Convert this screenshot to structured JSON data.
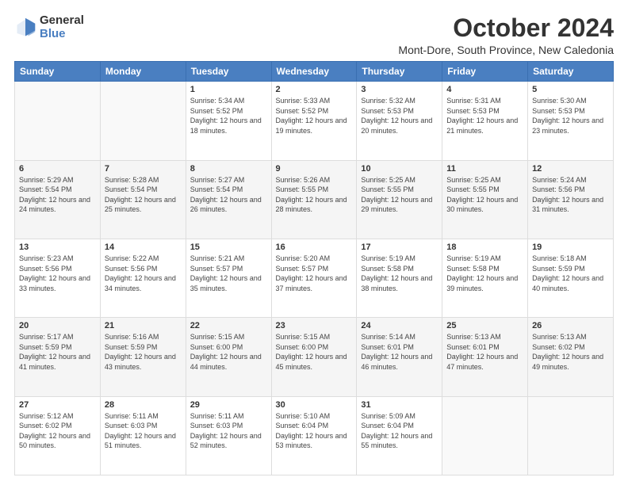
{
  "logo": {
    "general": "General",
    "blue": "Blue"
  },
  "header": {
    "month": "October 2024",
    "location": "Mont-Dore, South Province, New Caledonia"
  },
  "weekdays": [
    "Sunday",
    "Monday",
    "Tuesday",
    "Wednesday",
    "Thursday",
    "Friday",
    "Saturday"
  ],
  "weeks": [
    [
      {
        "day": "",
        "sunrise": "",
        "sunset": "",
        "daylight": ""
      },
      {
        "day": "",
        "sunrise": "",
        "sunset": "",
        "daylight": ""
      },
      {
        "day": "1",
        "sunrise": "Sunrise: 5:34 AM",
        "sunset": "Sunset: 5:52 PM",
        "daylight": "Daylight: 12 hours and 18 minutes."
      },
      {
        "day": "2",
        "sunrise": "Sunrise: 5:33 AM",
        "sunset": "Sunset: 5:52 PM",
        "daylight": "Daylight: 12 hours and 19 minutes."
      },
      {
        "day": "3",
        "sunrise": "Sunrise: 5:32 AM",
        "sunset": "Sunset: 5:53 PM",
        "daylight": "Daylight: 12 hours and 20 minutes."
      },
      {
        "day": "4",
        "sunrise": "Sunrise: 5:31 AM",
        "sunset": "Sunset: 5:53 PM",
        "daylight": "Daylight: 12 hours and 21 minutes."
      },
      {
        "day": "5",
        "sunrise": "Sunrise: 5:30 AM",
        "sunset": "Sunset: 5:53 PM",
        "daylight": "Daylight: 12 hours and 23 minutes."
      }
    ],
    [
      {
        "day": "6",
        "sunrise": "Sunrise: 5:29 AM",
        "sunset": "Sunset: 5:54 PM",
        "daylight": "Daylight: 12 hours and 24 minutes."
      },
      {
        "day": "7",
        "sunrise": "Sunrise: 5:28 AM",
        "sunset": "Sunset: 5:54 PM",
        "daylight": "Daylight: 12 hours and 25 minutes."
      },
      {
        "day": "8",
        "sunrise": "Sunrise: 5:27 AM",
        "sunset": "Sunset: 5:54 PM",
        "daylight": "Daylight: 12 hours and 26 minutes."
      },
      {
        "day": "9",
        "sunrise": "Sunrise: 5:26 AM",
        "sunset": "Sunset: 5:55 PM",
        "daylight": "Daylight: 12 hours and 28 minutes."
      },
      {
        "day": "10",
        "sunrise": "Sunrise: 5:25 AM",
        "sunset": "Sunset: 5:55 PM",
        "daylight": "Daylight: 12 hours and 29 minutes."
      },
      {
        "day": "11",
        "sunrise": "Sunrise: 5:25 AM",
        "sunset": "Sunset: 5:55 PM",
        "daylight": "Daylight: 12 hours and 30 minutes."
      },
      {
        "day": "12",
        "sunrise": "Sunrise: 5:24 AM",
        "sunset": "Sunset: 5:56 PM",
        "daylight": "Daylight: 12 hours and 31 minutes."
      }
    ],
    [
      {
        "day": "13",
        "sunrise": "Sunrise: 5:23 AM",
        "sunset": "Sunset: 5:56 PM",
        "daylight": "Daylight: 12 hours and 33 minutes."
      },
      {
        "day": "14",
        "sunrise": "Sunrise: 5:22 AM",
        "sunset": "Sunset: 5:56 PM",
        "daylight": "Daylight: 12 hours and 34 minutes."
      },
      {
        "day": "15",
        "sunrise": "Sunrise: 5:21 AM",
        "sunset": "Sunset: 5:57 PM",
        "daylight": "Daylight: 12 hours and 35 minutes."
      },
      {
        "day": "16",
        "sunrise": "Sunrise: 5:20 AM",
        "sunset": "Sunset: 5:57 PM",
        "daylight": "Daylight: 12 hours and 37 minutes."
      },
      {
        "day": "17",
        "sunrise": "Sunrise: 5:19 AM",
        "sunset": "Sunset: 5:58 PM",
        "daylight": "Daylight: 12 hours and 38 minutes."
      },
      {
        "day": "18",
        "sunrise": "Sunrise: 5:19 AM",
        "sunset": "Sunset: 5:58 PM",
        "daylight": "Daylight: 12 hours and 39 minutes."
      },
      {
        "day": "19",
        "sunrise": "Sunrise: 5:18 AM",
        "sunset": "Sunset: 5:59 PM",
        "daylight": "Daylight: 12 hours and 40 minutes."
      }
    ],
    [
      {
        "day": "20",
        "sunrise": "Sunrise: 5:17 AM",
        "sunset": "Sunset: 5:59 PM",
        "daylight": "Daylight: 12 hours and 41 minutes."
      },
      {
        "day": "21",
        "sunrise": "Sunrise: 5:16 AM",
        "sunset": "Sunset: 5:59 PM",
        "daylight": "Daylight: 12 hours and 43 minutes."
      },
      {
        "day": "22",
        "sunrise": "Sunrise: 5:15 AM",
        "sunset": "Sunset: 6:00 PM",
        "daylight": "Daylight: 12 hours and 44 minutes."
      },
      {
        "day": "23",
        "sunrise": "Sunrise: 5:15 AM",
        "sunset": "Sunset: 6:00 PM",
        "daylight": "Daylight: 12 hours and 45 minutes."
      },
      {
        "day": "24",
        "sunrise": "Sunrise: 5:14 AM",
        "sunset": "Sunset: 6:01 PM",
        "daylight": "Daylight: 12 hours and 46 minutes."
      },
      {
        "day": "25",
        "sunrise": "Sunrise: 5:13 AM",
        "sunset": "Sunset: 6:01 PM",
        "daylight": "Daylight: 12 hours and 47 minutes."
      },
      {
        "day": "26",
        "sunrise": "Sunrise: 5:13 AM",
        "sunset": "Sunset: 6:02 PM",
        "daylight": "Daylight: 12 hours and 49 minutes."
      }
    ],
    [
      {
        "day": "27",
        "sunrise": "Sunrise: 5:12 AM",
        "sunset": "Sunset: 6:02 PM",
        "daylight": "Daylight: 12 hours and 50 minutes."
      },
      {
        "day": "28",
        "sunrise": "Sunrise: 5:11 AM",
        "sunset": "Sunset: 6:03 PM",
        "daylight": "Daylight: 12 hours and 51 minutes."
      },
      {
        "day": "29",
        "sunrise": "Sunrise: 5:11 AM",
        "sunset": "Sunset: 6:03 PM",
        "daylight": "Daylight: 12 hours and 52 minutes."
      },
      {
        "day": "30",
        "sunrise": "Sunrise: 5:10 AM",
        "sunset": "Sunset: 6:04 PM",
        "daylight": "Daylight: 12 hours and 53 minutes."
      },
      {
        "day": "31",
        "sunrise": "Sunrise: 5:09 AM",
        "sunset": "Sunset: 6:04 PM",
        "daylight": "Daylight: 12 hours and 55 minutes."
      },
      {
        "day": "",
        "sunrise": "",
        "sunset": "",
        "daylight": ""
      },
      {
        "day": "",
        "sunrise": "",
        "sunset": "",
        "daylight": ""
      }
    ]
  ]
}
